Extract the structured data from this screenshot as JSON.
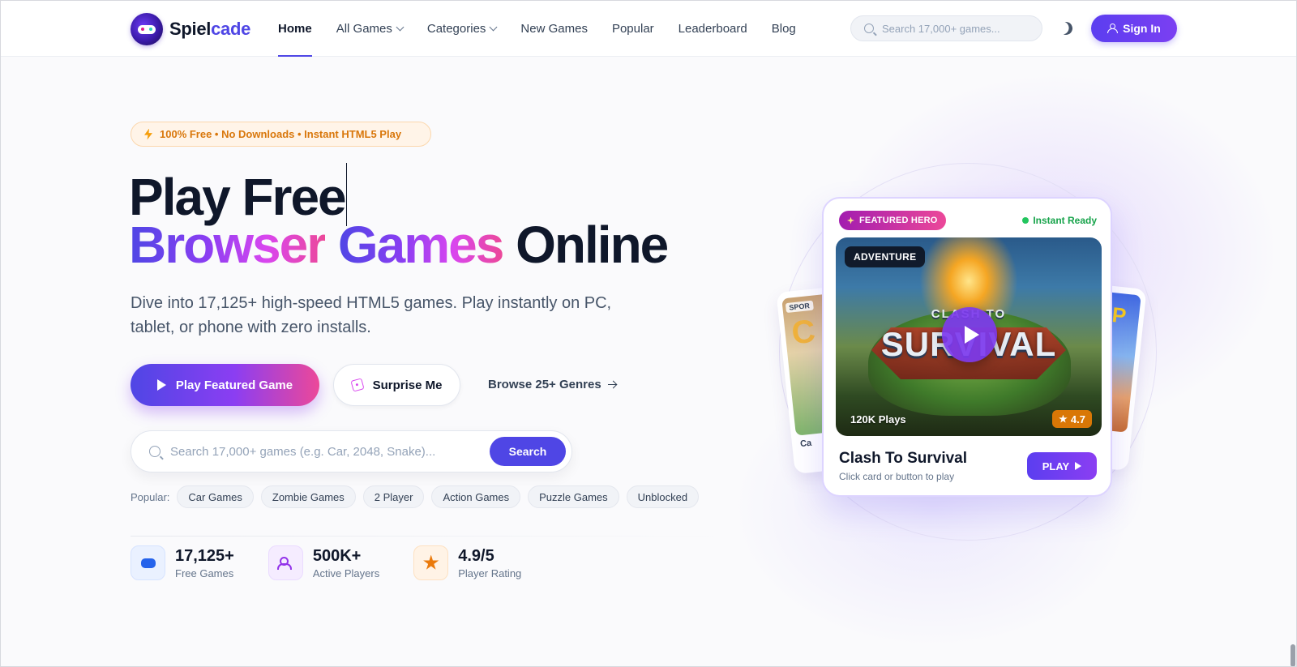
{
  "brand": {
    "name_a": "Spiel",
    "name_b": "cade"
  },
  "nav": {
    "items": [
      {
        "label": "Home",
        "active": true,
        "dropdown": false
      },
      {
        "label": "All Games",
        "active": false,
        "dropdown": true
      },
      {
        "label": "Categories",
        "active": false,
        "dropdown": true
      },
      {
        "label": "New Games",
        "active": false,
        "dropdown": false
      },
      {
        "label": "Popular",
        "active": false,
        "dropdown": false
      },
      {
        "label": "Leaderboard",
        "active": false,
        "dropdown": false
      },
      {
        "label": "Blog",
        "active": false,
        "dropdown": false
      }
    ],
    "search_placeholder": "Search 17,000+ games...",
    "signin_label": "Sign In"
  },
  "hero": {
    "badge": "100% Free • No Downloads • Instant HTML5 Play",
    "title_line1": "Play Free",
    "title_grad_a": "Browser",
    "title_grad_b": "Games",
    "title_plain": "Online",
    "subtitle": "Dive into 17,125+ high-speed HTML5 games. Play instantly on PC, tablet, or phone with zero installs.",
    "play_button": "Play Featured Game",
    "surprise_button": "Surprise Me",
    "browse_link": "Browse 25+ Genres",
    "search_placeholder": "Search 17,000+ games (e.g. Car, 2048, Snake)...",
    "search_button": "Search",
    "popular_label": "Popular:",
    "popular_tags": [
      "Car Games",
      "Zombie Games",
      "2 Player",
      "Action Games",
      "Puzzle Games",
      "Unblocked"
    ],
    "stats": [
      {
        "value": "17,125+",
        "label": "Free Games",
        "icon": "gamepad-icon"
      },
      {
        "value": "500K+",
        "label": "Active Players",
        "icon": "users-icon"
      },
      {
        "value": "4.9/5",
        "label": "Player Rating",
        "icon": "star-icon"
      }
    ]
  },
  "featured": {
    "pill": "FEATURED HERO",
    "status": "Instant Ready",
    "genre": "ADVENTURE",
    "art_top": "CLASH TO",
    "art_main": "SURVIVAL",
    "plays": "120K Plays",
    "rating": "4.7",
    "title": "Clash To Survival",
    "hint": "Click card or button to play",
    "play_label": "PLAY",
    "left_card": {
      "tag": "SPOR",
      "letter": "C",
      "title": "Ca"
    },
    "right_card": {
      "letter": "UP",
      "meta": "ys"
    }
  },
  "colors": {
    "accent": "#4f46e5",
    "pink": "#ec4899",
    "purple": "#8b3ef2",
    "orange": "#d97706",
    "green": "#22c55e"
  }
}
